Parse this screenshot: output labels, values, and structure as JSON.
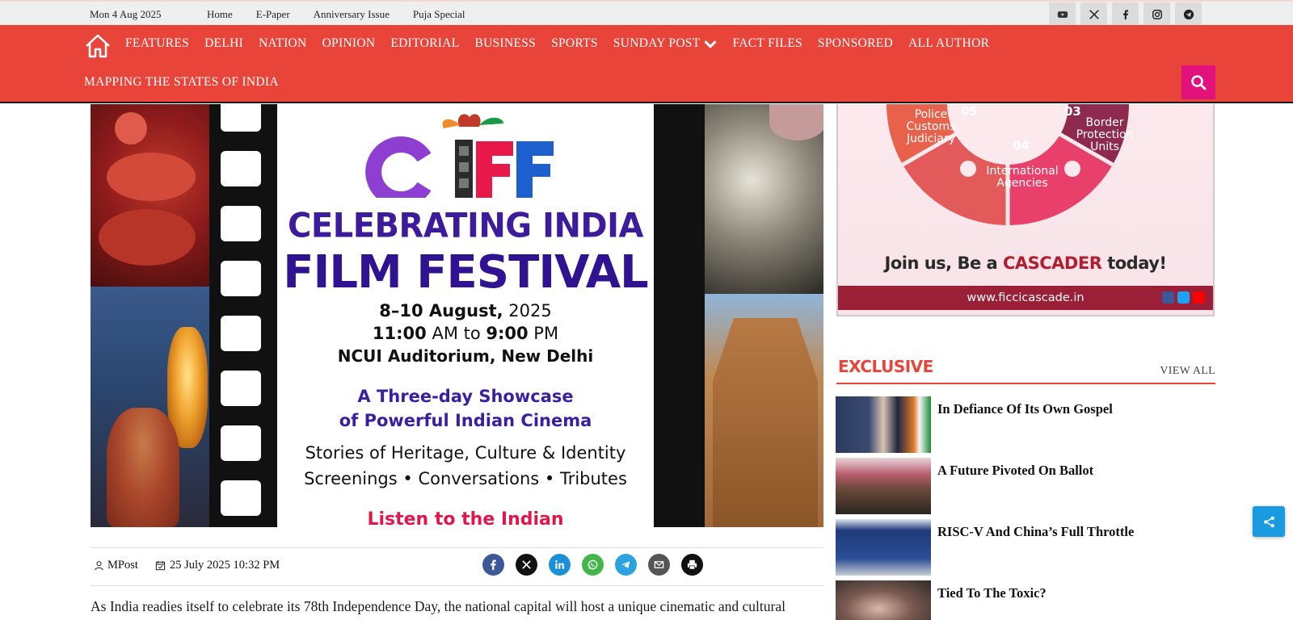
{
  "topbar": {
    "date": "Mon 4 Aug 2025",
    "links": [
      "Home",
      "E-Paper",
      "Anniversary Issue",
      "Puja Special"
    ],
    "social_icons": [
      "youtube-icon",
      "x-icon",
      "facebook-icon",
      "instagram-icon",
      "telegram-icon"
    ]
  },
  "nav": {
    "items": [
      "FEATURES",
      "DELHI",
      "NATION",
      "OPINION",
      "EDITORIAL",
      "BUSINESS",
      "SPORTS",
      "SUNDAY POST",
      "FACT FILES",
      "SPONSORED",
      "ALL AUTHOR"
    ],
    "row2": "MAPPING THE STATES OF INDIA",
    "color": "#e8443a",
    "search_color": "#e2117b"
  },
  "poster": {
    "logo": "CIFF",
    "line1": "CELEBRATING INDIA",
    "line2": "FILM FESTIVAL",
    "dates_bold": "8–10 August,",
    "dates_rest": " 2025",
    "time_start": "11:00",
    "time_start_suffix": " AM to ",
    "time_end": "9:00",
    "time_end_suffix": " PM",
    "venue": "NCUI Auditorium, New Delhi",
    "showcase1": "A Three-day Showcase",
    "showcase2": "of Powerful Indian Cinema",
    "stories": "Stories of Heritage, Culture & Identity",
    "screenings": "Screenings • Conversations • Tributes",
    "tagline_cut": "Listen to the Indian"
  },
  "meta": {
    "author": "MPost",
    "date": "25 July 2025 10:32 PM",
    "share_icons": [
      "facebook-icon",
      "x-icon",
      "linkedin-icon",
      "whatsapp-icon",
      "telegram-icon",
      "email-icon",
      "print-icon"
    ]
  },
  "article": {
    "intro": "As India readies itself to celebrate its 78th Independence Day, the national capital will host a unique cinematic and cultural"
  },
  "ad": {
    "labels": {
      "n05": "05",
      "l05": "Police\nCustoms\nJudiciary",
      "n03": "03",
      "l03": "Border\nProtection\nUnits",
      "n04": "04",
      "l04": "International\nAgencies"
    },
    "join_prefix": "Join us, Be a ",
    "join_highlight": "CASCADER",
    "join_suffix": " today!",
    "url": "www.ficcicascade.in"
  },
  "exclusive": {
    "heading": "EXCLUSIVE",
    "view_all": "VIEW ALL",
    "stories": [
      {
        "title": "In Defiance Of Its Own Gospel"
      },
      {
        "title": "A Future Pivoted On Ballot"
      },
      {
        "title": "RISC-V And China’s Full Throttle"
      },
      {
        "title": "Tied To The Toxic?"
      }
    ]
  }
}
